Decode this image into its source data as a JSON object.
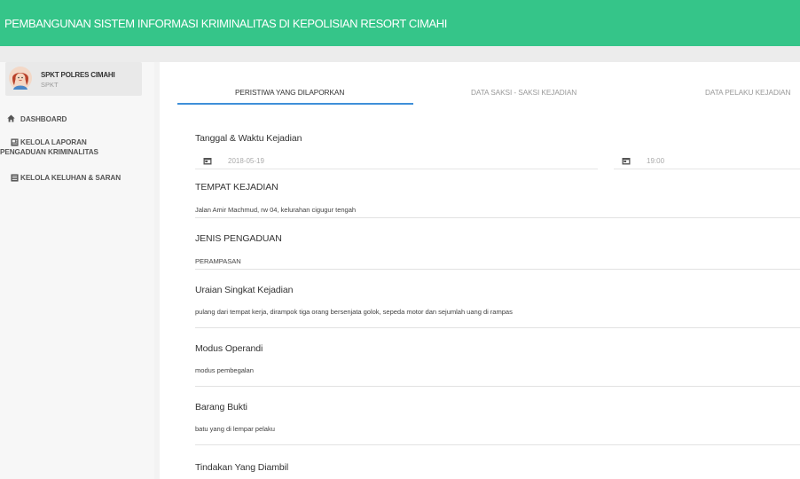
{
  "app": {
    "title": "PEMBANGUNAN SISTEM INFORMASI KRIMINALITAS DI KEPOLISIAN RESORT CIMAHI",
    "accent_color": "#35c589",
    "tab_underline_color": "#3f8fd9"
  },
  "profile": {
    "name": "SPKT POLRES CIMAHI",
    "role": "SPKT",
    "avatar_icon": "user-avatar-icon"
  },
  "sidebar": {
    "items": [
      {
        "icon": "home-icon",
        "label": "DASHBOARD"
      },
      {
        "icon": "report-icon",
        "label_line1": "KELOLA LAPORAN",
        "label_line2": "PENGADUAN KRIMINALITAS"
      },
      {
        "icon": "list-icon",
        "label": "KELOLA KELUHAN & SARAN"
      }
    ]
  },
  "tabs": [
    {
      "label": "PERISTIWA YANG DILAPORKAN",
      "active": true
    },
    {
      "label": "DATA SAKSI - SAKSI KEJADIAN",
      "active": false
    },
    {
      "label": "DATA PELAKU KEJADIAN",
      "active": false
    }
  ],
  "form": {
    "datetime": {
      "label": "Tanggal & Waktu Kejadian",
      "date_value": "2018-05-19",
      "time_value": "19:00"
    },
    "fields": [
      {
        "label": "TEMPAT KEJADIAN",
        "value": "Jalan Amir Machmud, rw 04, kelurahan cigugur tengah"
      },
      {
        "label": "JENIS PENGADUAN",
        "value": "PERAMPASAN"
      },
      {
        "label": "Uraian Singkat Kejadian",
        "value": "pulang dari tempat kerja, dirampok tiga orang bersenjata golok, sepeda motor dan sejumlah uang di rampas"
      },
      {
        "label": "Modus Operandi",
        "value": "modus pembegalan"
      },
      {
        "label": "Barang Bukti",
        "value": "batu yang di lempar pelaku"
      },
      {
        "label": "Tindakan Yang Diambil",
        "value": ""
      }
    ]
  }
}
